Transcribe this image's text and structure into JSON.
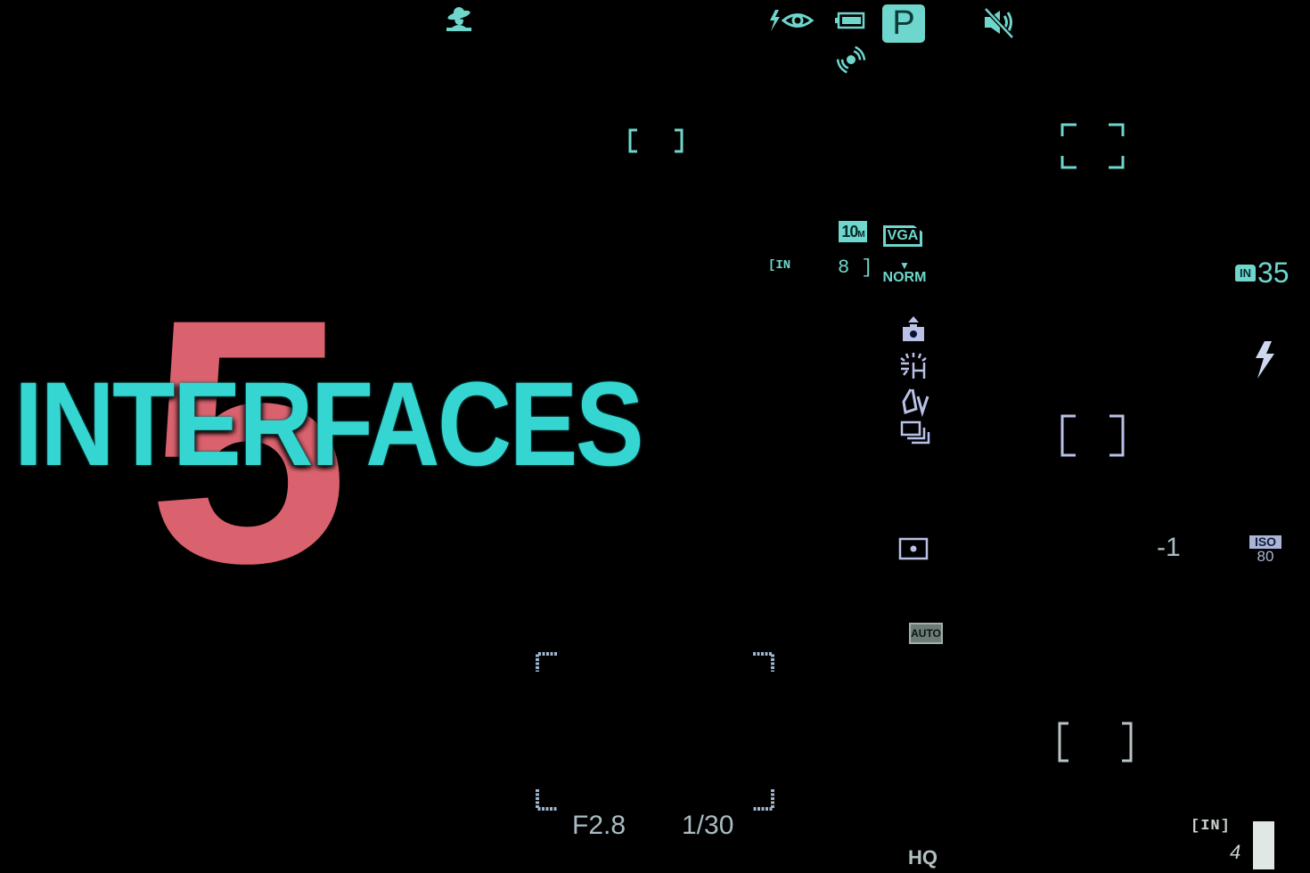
{
  "screen": {
    "type": "camera-viewfinder-overlay",
    "colors": {
      "background": "#000000",
      "primary_teal": "#6ed6cc",
      "logo_cyan": "#35d6d2",
      "logo_red": "#d9626e",
      "lavender": "#b9c2e6",
      "grey_text": "#a9bcc3"
    }
  },
  "logo": {
    "number": "5",
    "word": "INTERFACES"
  },
  "top_bar": {
    "icons": [
      {
        "name": "scene-portrait-icon",
        "label": "Portrait scene"
      },
      {
        "name": "red-eye-flash-icon",
        "label": "Red-eye flash"
      },
      {
        "name": "battery-icon",
        "label": "Battery"
      },
      {
        "name": "vibration-icon",
        "label": "Image stabilization"
      },
      {
        "name": "sound-muted-icon",
        "label": "Sound off"
      }
    ],
    "mode": "P"
  },
  "status": {
    "image_size": {
      "main": "10",
      "suffix": "M"
    },
    "video_size": "VGA",
    "quality": "NORM",
    "memory_left": "[IN",
    "shots_left": "8 ]",
    "internal_memory_badge": "IN",
    "remaining_count": "35"
  },
  "side_icons": [
    {
      "name": "camera-up-icon"
    },
    {
      "name": "white-balance-fluorescent-icon"
    },
    {
      "name": "bracket-ev-icon"
    },
    {
      "name": "continuous-shooting-icon"
    },
    {
      "name": "spot-metering-icon"
    }
  ],
  "exposure": {
    "aperture": "F2.8",
    "shutter": "1/30",
    "ev": "-1",
    "iso_label": "ISO",
    "iso_value": "80",
    "auto_label": "AUTO",
    "quality_mode": "HQ"
  },
  "flash": {
    "icon": "flash-icon"
  },
  "bottom_right": {
    "memory_label": "[IN]",
    "count": "4"
  }
}
